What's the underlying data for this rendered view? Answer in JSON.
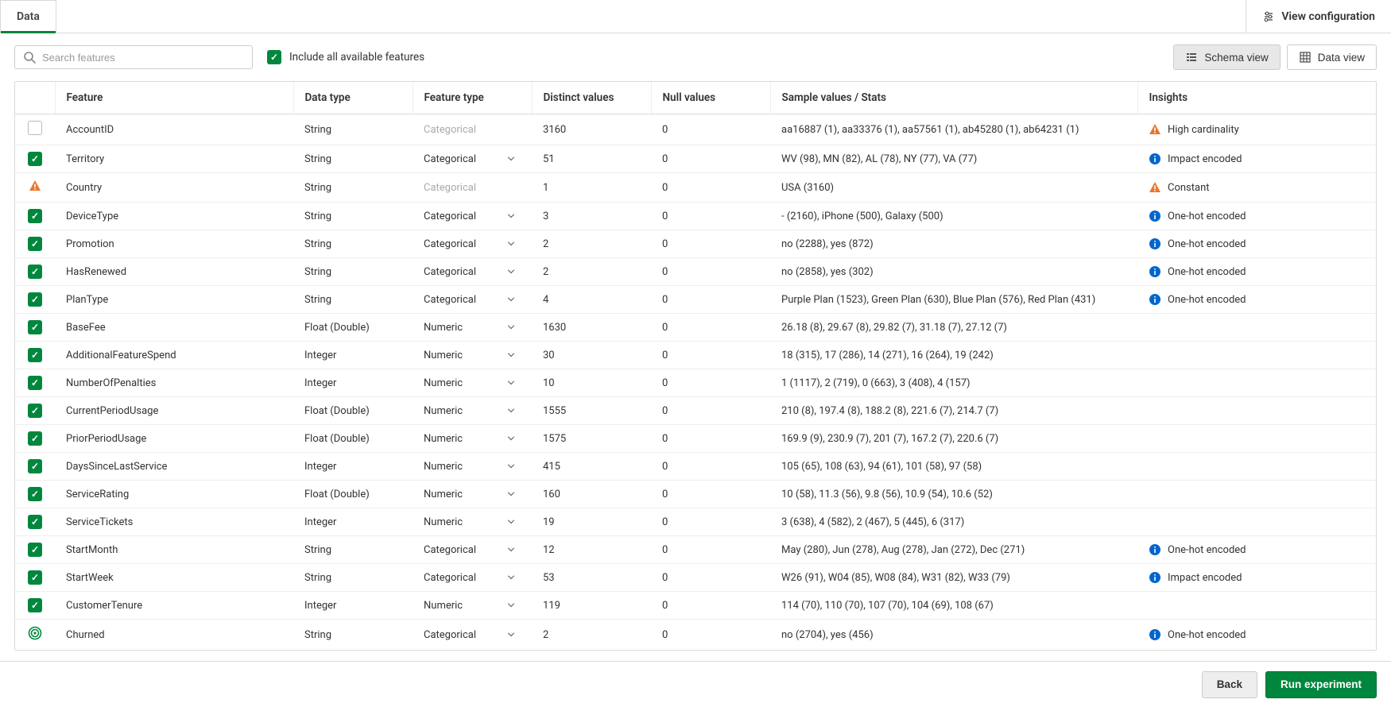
{
  "tabs": {
    "data": "Data"
  },
  "viewConfig": "View configuration",
  "toolbar": {
    "searchPlaceholder": "Search features",
    "includeAll": "Include all available features",
    "schemaView": "Schema view",
    "dataView": "Data view"
  },
  "columns": {
    "feature": "Feature",
    "dataType": "Data type",
    "featureType": "Feature type",
    "distinct": "Distinct values",
    "nulls": "Null values",
    "sample": "Sample values / Stats",
    "insights": "Insights"
  },
  "ftypes": {
    "categorical": "Categorical",
    "numeric": "Numeric"
  },
  "insightsText": {
    "highCardinality": "High cardinality",
    "impactEncoded": "Impact encoded",
    "constant": "Constant",
    "oneHot": "One-hot encoded"
  },
  "rows": [
    {
      "sel": "empty",
      "feature": "AccountID",
      "dtype": "String",
      "ftype": "categorical",
      "ftDisabled": true,
      "distinct": "3160",
      "nulls": "0",
      "sample": "aa16887 (1), aa33376 (1), aa57561 (1), ab45280 (1), ab64231 (1)",
      "insIcon": "warn",
      "insText": "highCardinality"
    },
    {
      "sel": "checked",
      "feature": "Territory",
      "dtype": "String",
      "ftype": "categorical",
      "ftDisabled": false,
      "distinct": "51",
      "nulls": "0",
      "sample": "WV (98), MN (82), AL (78), NY (77), VA (77)",
      "insIcon": "info",
      "insText": "impactEncoded"
    },
    {
      "sel": "warn",
      "feature": "Country",
      "dtype": "String",
      "ftype": "categorical",
      "ftDisabled": true,
      "distinct": "1",
      "nulls": "0",
      "sample": "USA (3160)",
      "insIcon": "warn",
      "insText": "constant"
    },
    {
      "sel": "checked",
      "feature": "DeviceType",
      "dtype": "String",
      "ftype": "categorical",
      "ftDisabled": false,
      "distinct": "3",
      "nulls": "0",
      "sample": "- (2160), iPhone (500), Galaxy (500)",
      "insIcon": "info",
      "insText": "oneHot"
    },
    {
      "sel": "checked",
      "feature": "Promotion",
      "dtype": "String",
      "ftype": "categorical",
      "ftDisabled": false,
      "distinct": "2",
      "nulls": "0",
      "sample": "no (2288), yes (872)",
      "insIcon": "info",
      "insText": "oneHot"
    },
    {
      "sel": "checked",
      "feature": "HasRenewed",
      "dtype": "String",
      "ftype": "categorical",
      "ftDisabled": false,
      "distinct": "2",
      "nulls": "0",
      "sample": "no (2858), yes (302)",
      "insIcon": "info",
      "insText": "oneHot"
    },
    {
      "sel": "checked",
      "feature": "PlanType",
      "dtype": "String",
      "ftype": "categorical",
      "ftDisabled": false,
      "distinct": "4",
      "nulls": "0",
      "sample": "Purple Plan (1523), Green Plan (630), Blue Plan (576), Red Plan (431)",
      "insIcon": "info",
      "insText": "oneHot"
    },
    {
      "sel": "checked",
      "feature": "BaseFee",
      "dtype": "Float (Double)",
      "ftype": "numeric",
      "ftDisabled": false,
      "distinct": "1630",
      "nulls": "0",
      "sample": "26.18 (8), 29.67 (8), 29.82 (7), 31.18 (7), 27.12 (7)",
      "insIcon": "",
      "insText": ""
    },
    {
      "sel": "checked",
      "feature": "AdditionalFeatureSpend",
      "dtype": "Integer",
      "ftype": "numeric",
      "ftDisabled": false,
      "distinct": "30",
      "nulls": "0",
      "sample": "18 (315), 17 (286), 14 (271), 16 (264), 19 (242)",
      "insIcon": "",
      "insText": ""
    },
    {
      "sel": "checked",
      "feature": "NumberOfPenalties",
      "dtype": "Integer",
      "ftype": "numeric",
      "ftDisabled": false,
      "distinct": "10",
      "nulls": "0",
      "sample": "1 (1117), 2 (719), 0 (663), 3 (408), 4 (157)",
      "insIcon": "",
      "insText": ""
    },
    {
      "sel": "checked",
      "feature": "CurrentPeriodUsage",
      "dtype": "Float (Double)",
      "ftype": "numeric",
      "ftDisabled": false,
      "distinct": "1555",
      "nulls": "0",
      "sample": "210 (8), 197.4 (8), 188.2 (8), 221.6 (7), 214.7 (7)",
      "insIcon": "",
      "insText": ""
    },
    {
      "sel": "checked",
      "feature": "PriorPeriodUsage",
      "dtype": "Float (Double)",
      "ftype": "numeric",
      "ftDisabled": false,
      "distinct": "1575",
      "nulls": "0",
      "sample": "169.9 (9), 230.9 (7), 201 (7), 167.2 (7), 220.6 (7)",
      "insIcon": "",
      "insText": ""
    },
    {
      "sel": "checked",
      "feature": "DaysSinceLastService",
      "dtype": "Integer",
      "ftype": "numeric",
      "ftDisabled": false,
      "distinct": "415",
      "nulls": "0",
      "sample": "105 (65), 108 (63), 94 (61), 101 (58), 97 (58)",
      "insIcon": "",
      "insText": ""
    },
    {
      "sel": "checked",
      "feature": "ServiceRating",
      "dtype": "Float (Double)",
      "ftype": "numeric",
      "ftDisabled": false,
      "distinct": "160",
      "nulls": "0",
      "sample": "10 (58), 11.3 (56), 9.8 (56), 10.9 (54), 10.6 (52)",
      "insIcon": "",
      "insText": ""
    },
    {
      "sel": "checked",
      "feature": "ServiceTickets",
      "dtype": "Integer",
      "ftype": "numeric",
      "ftDisabled": false,
      "distinct": "19",
      "nulls": "0",
      "sample": "3 (638), 4 (582), 2 (467), 5 (445), 6 (317)",
      "insIcon": "",
      "insText": ""
    },
    {
      "sel": "checked",
      "feature": "StartMonth",
      "dtype": "String",
      "ftype": "categorical",
      "ftDisabled": false,
      "distinct": "12",
      "nulls": "0",
      "sample": "May (280), Jun (278), Aug (278), Jan (272), Dec (271)",
      "insIcon": "info",
      "insText": "oneHot"
    },
    {
      "sel": "checked",
      "feature": "StartWeek",
      "dtype": "String",
      "ftype": "categorical",
      "ftDisabled": false,
      "distinct": "53",
      "nulls": "0",
      "sample": "W26 (91), W04 (85), W08 (84), W31 (82), W33 (79)",
      "insIcon": "info",
      "insText": "impactEncoded"
    },
    {
      "sel": "checked",
      "feature": "CustomerTenure",
      "dtype": "Integer",
      "ftype": "numeric",
      "ftDisabled": false,
      "distinct": "119",
      "nulls": "0",
      "sample": "114 (70), 110 (70), 107 (70), 104 (69), 108 (67)",
      "insIcon": "",
      "insText": ""
    },
    {
      "sel": "target",
      "feature": "Churned",
      "dtype": "String",
      "ftype": "categorical",
      "ftDisabled": false,
      "distinct": "2",
      "nulls": "0",
      "sample": "no (2704), yes (456)",
      "insIcon": "info",
      "insText": "oneHot"
    }
  ],
  "footer": {
    "back": "Back",
    "run": "Run experiment"
  }
}
